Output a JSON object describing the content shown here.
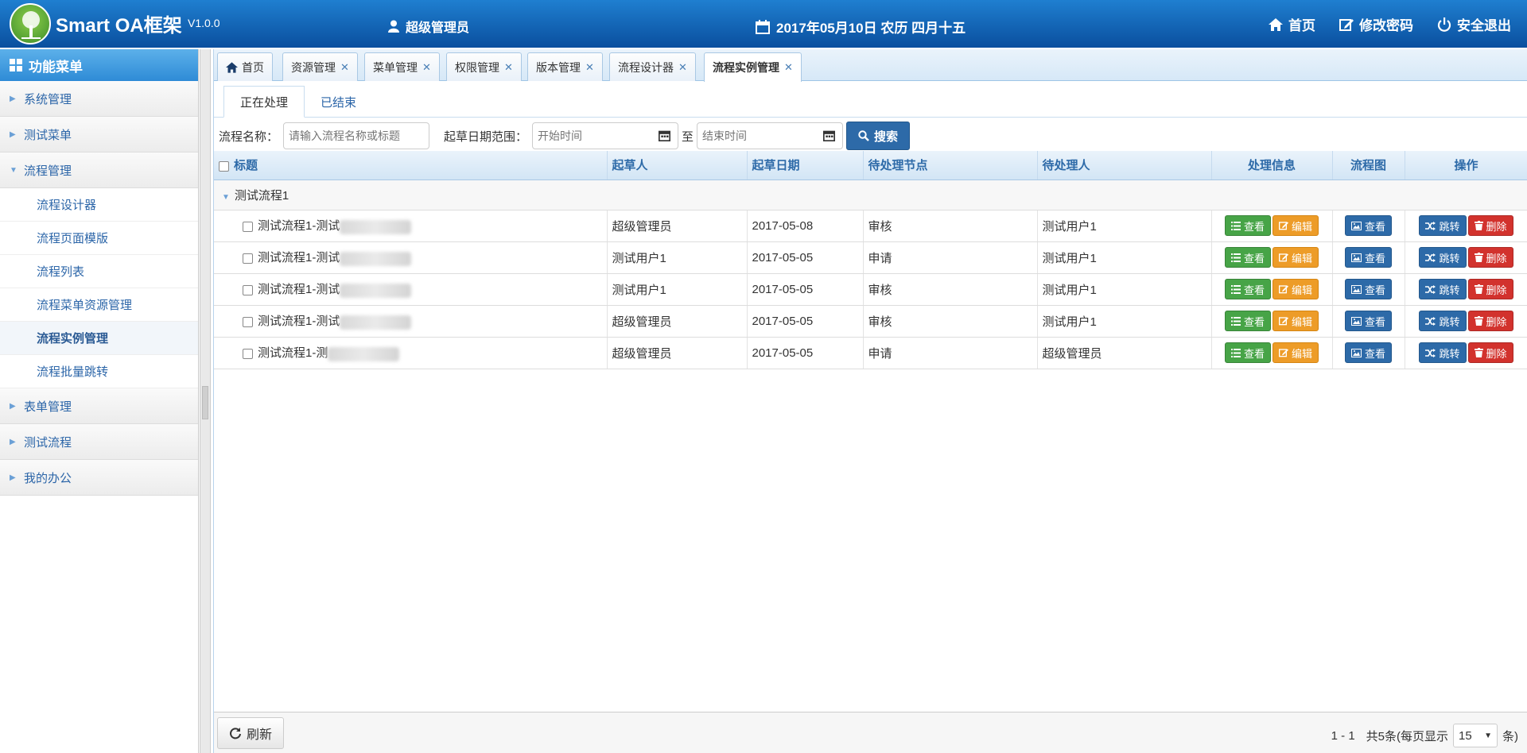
{
  "header": {
    "app_title": "Smart OA框架",
    "version": "V1.0.0",
    "user": "超级管理员",
    "date": "2017年05月10日 农历 四月十五",
    "nav": [
      {
        "label": "首页",
        "icon": "home-icon"
      },
      {
        "label": "修改密码",
        "icon": "edit-icon"
      },
      {
        "label": "安全退出",
        "icon": "power-icon"
      }
    ]
  },
  "sidebar": {
    "title": "功能菜单",
    "groups": [
      {
        "label": "系统管理"
      },
      {
        "label": "测试菜单"
      },
      {
        "label": "流程管理",
        "expanded": true,
        "items": [
          "流程设计器",
          "流程页面模版",
          "流程列表",
          "流程菜单资源管理",
          "流程实例管理",
          "流程批量跳转"
        ],
        "active": "流程实例管理"
      },
      {
        "label": "表单管理"
      },
      {
        "label": "测试流程"
      },
      {
        "label": "我的办公"
      }
    ]
  },
  "tabs": [
    {
      "label": "首页",
      "closable": false
    },
    {
      "label": "资源管理",
      "closable": true
    },
    {
      "label": "菜单管理",
      "closable": true
    },
    {
      "label": "权限管理",
      "closable": true
    },
    {
      "label": "版本管理",
      "closable": true
    },
    {
      "label": "流程设计器",
      "closable": true
    },
    {
      "label": "流程实例管理",
      "closable": true,
      "active": true
    }
  ],
  "subtabs": [
    "正在处理",
    "已结束"
  ],
  "filters": {
    "name_label": "流程名称：",
    "name_placeholder": "请输入流程名称或标题",
    "date_label": "起草日期范围：",
    "start_placeholder": "开始时间",
    "to_label": "至",
    "end_placeholder": "结束时间",
    "search_label": "搜索"
  },
  "grid": {
    "columns": [
      "标题",
      "起草人",
      "起草日期",
      "待处理节点",
      "待处理人",
      "处理信息",
      "流程图",
      "操作"
    ],
    "group_label": "测试流程1",
    "rows": [
      {
        "title": "测试流程1-测试",
        "drafter": "超级管理员",
        "date": "2017-05-08",
        "node": "审核",
        "handler": "测试用户1"
      },
      {
        "title": "测试流程1-测试",
        "drafter": "测试用户1",
        "date": "2017-05-05",
        "node": "申请",
        "handler": "测试用户1"
      },
      {
        "title": "测试流程1-测试",
        "drafter": "测试用户1",
        "date": "2017-05-05",
        "node": "审核",
        "handler": "测试用户1"
      },
      {
        "title": "测试流程1-测试",
        "drafter": "超级管理员",
        "date": "2017-05-05",
        "node": "审核",
        "handler": "测试用户1"
      },
      {
        "title": "测试流程1-测",
        "drafter": "超级管理员",
        "date": "2017-05-05",
        "node": "申请",
        "handler": "超级管理员"
      }
    ],
    "btn_view": "查看",
    "btn_edit": "编辑",
    "btn_jump": "跳转",
    "btn_delete": "删除"
  },
  "footer": {
    "refresh_label": "刷新",
    "range": "1 - 1",
    "total_prefix": "共5条(每页显示",
    "page_size": "15",
    "total_suffix": "条)"
  }
}
